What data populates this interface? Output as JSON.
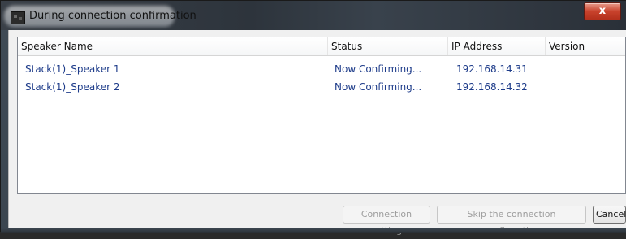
{
  "window": {
    "title": "During connection confirmation",
    "close_label": "x"
  },
  "list": {
    "columns": [
      "Speaker Name",
      "Status",
      "IP Address",
      "Version"
    ],
    "rows": [
      {
        "speaker_name": "Stack(1)_Speaker 1",
        "status": "Now Confirming...",
        "ip_address": "192.168.14.31",
        "version": ""
      },
      {
        "speaker_name": "Stack(1)_Speaker 2",
        "status": "Now Confirming...",
        "ip_address": "192.168.14.32",
        "version": ""
      }
    ]
  },
  "buttons": {
    "connection_setting": "Connection setting",
    "skip_confirmation": "Skip the connection confirmation",
    "cancel": "Cancel"
  },
  "colors": {
    "row_text": "#1e3c8a",
    "close_button": "#c8422c"
  }
}
